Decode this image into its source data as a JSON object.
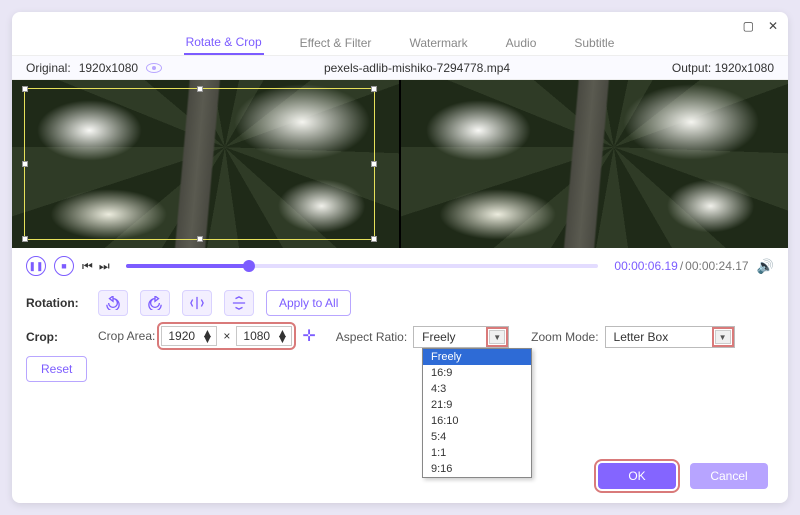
{
  "window": {
    "maximize": "▢",
    "close": "✕"
  },
  "tabs": {
    "rotate_crop": "Rotate & Crop",
    "effect_filter": "Effect & Filter",
    "watermark": "Watermark",
    "audio": "Audio",
    "subtitle": "Subtitle"
  },
  "subbar": {
    "original_label": "Original:",
    "original_dims": "1920x1080",
    "filename": "pexels-adlib-mishiko-7294778.mp4",
    "output_label": "Output:",
    "output_dims": "1920x1080"
  },
  "playback": {
    "current": "00:00:06.19",
    "sep": "/",
    "total": "00:00:24.17"
  },
  "rotation": {
    "label": "Rotation:",
    "apply_all": "Apply to All"
  },
  "crop": {
    "label": "Crop:",
    "area_label": "Crop Area:",
    "width": "1920",
    "times": "×",
    "height": "1080",
    "aspect_label": "Aspect Ratio:",
    "aspect_value": "Freely",
    "aspect_options": [
      "Freely",
      "16:9",
      "4:3",
      "21:9",
      "16:10",
      "5:4",
      "1:1",
      "9:16"
    ],
    "zoom_label": "Zoom Mode:",
    "zoom_value": "Letter Box",
    "reset": "Reset"
  },
  "footer": {
    "ok": "OK",
    "cancel": "Cancel"
  }
}
